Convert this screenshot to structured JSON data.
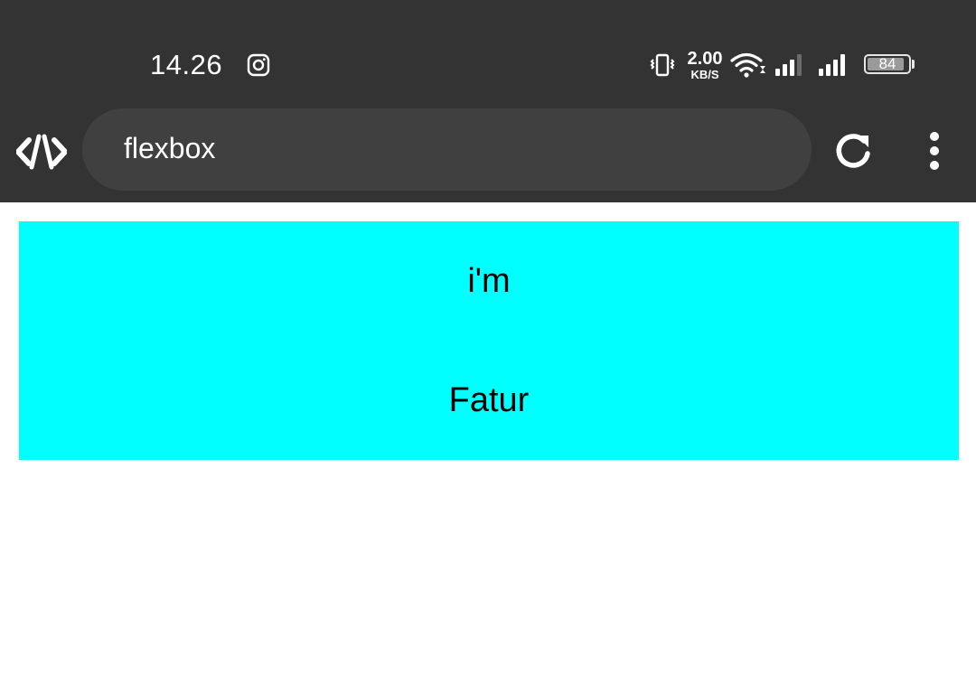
{
  "status_bar": {
    "time": "14.26",
    "notification_icon": "instagram-icon",
    "network_speed": "2.00",
    "network_speed_unit": "KB/S",
    "battery_level": "84",
    "icons": [
      "vibrate-icon",
      "wifi-icon",
      "signal-icon",
      "signal-icon",
      "battery-icon"
    ]
  },
  "toolbar": {
    "app_icon": "code-icon",
    "address": "flexbox",
    "reload_icon": "reload-icon",
    "menu_icon": "more-vert-icon"
  },
  "page": {
    "background": "#ffffff",
    "flex_container_color": "#00ffff",
    "items": [
      "i'm",
      "Fatur"
    ]
  },
  "colors": {
    "chrome": "#333333",
    "address_bar": "#404040"
  }
}
